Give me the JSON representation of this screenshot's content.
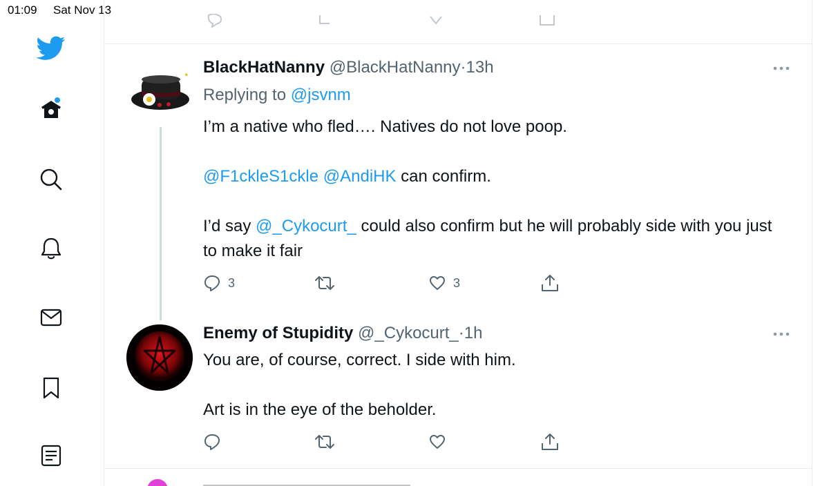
{
  "status_bar": {
    "time": "01:09",
    "date": "Sat Nov 13"
  },
  "sidebar": {
    "items": [
      {
        "icon": "twitter-logo-icon"
      },
      {
        "icon": "home-icon",
        "has_dot": true
      },
      {
        "icon": "search-icon"
      },
      {
        "icon": "notifications-bell-icon"
      },
      {
        "icon": "messages-mail-icon"
      },
      {
        "icon": "bookmark-icon"
      },
      {
        "icon": "lists-icon"
      }
    ]
  },
  "colors": {
    "accent": "#1d9bf0",
    "text": "#0f1419",
    "muted": "#536471",
    "border": "#e6ecf0"
  },
  "tweets": [
    {
      "name": "BlackHatNanny",
      "handle": "@BlackHatNanny",
      "dot": "·",
      "time": "13h",
      "replying_prefix": "Replying to ",
      "replying_to": "@jsvnm",
      "line1": "I’m a native who fled…. Natives do not love poop.",
      "mention1": "@F1ckleS1ckle",
      "mention2": "@AndiHK",
      "line2_rest": " can confirm.",
      "line3_pre": "I’d say ",
      "mention3": "@_Cykocurt_",
      "line3_post": " could also confirm but he will probably side with you just to make it fair",
      "replies": "3",
      "likes": "3"
    },
    {
      "name": "Enemy of Stupidity",
      "handle": "@_Cykocurt_",
      "dot": "·",
      "time": "1h",
      "line1": "You are, of course, correct. I side with him.",
      "line2": "Art is in the eye of the beholder."
    }
  ]
}
